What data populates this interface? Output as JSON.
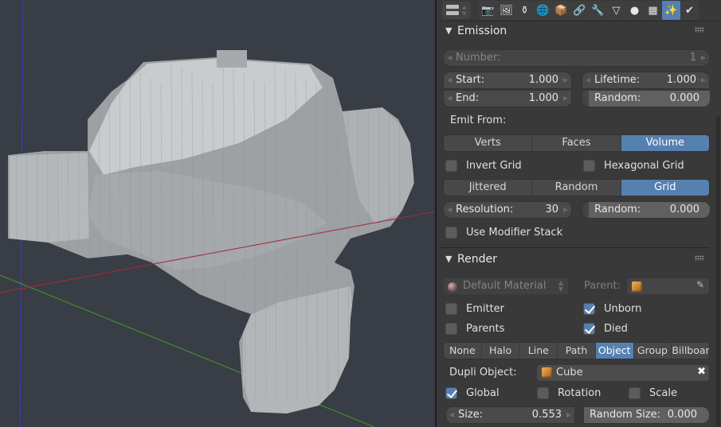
{
  "header": {
    "tabs": [
      {
        "name": "render-tab",
        "icon": "camera-icon",
        "glyph": "📷",
        "active": false
      },
      {
        "name": "render-layers-tab",
        "icon": "render-layers-icon",
        "glyph": "🖼",
        "active": false
      },
      {
        "name": "scene-tab",
        "icon": "scene-icon",
        "glyph": "⚱",
        "active": false
      },
      {
        "name": "world-tab",
        "icon": "world-icon",
        "glyph": "🌐",
        "active": false
      },
      {
        "name": "object-tab",
        "icon": "object-cube-icon",
        "glyph": "📦",
        "active": false
      },
      {
        "name": "constraints-tab",
        "icon": "link-icon",
        "glyph": "🔗",
        "active": false
      },
      {
        "name": "modifiers-tab",
        "icon": "wrench-icon",
        "glyph": "🔧",
        "active": false
      },
      {
        "name": "data-tab",
        "icon": "vertex-triangle-icon",
        "glyph": "▽",
        "active": false
      },
      {
        "name": "material-tab",
        "icon": "material-sphere-icon",
        "glyph": "●",
        "active": false
      },
      {
        "name": "texture-tab",
        "icon": "checker-texture-icon",
        "glyph": "▦",
        "active": false
      },
      {
        "name": "particles-tab",
        "icon": "particles-icon",
        "glyph": "✨",
        "active": true
      },
      {
        "name": "physics-tab",
        "icon": "physics-icon",
        "glyph": "✔",
        "active": false
      }
    ]
  },
  "emission": {
    "title": "Emission",
    "number": {
      "label": "Number:",
      "value": "1"
    },
    "start": {
      "label": "Start:",
      "value": "1.000"
    },
    "end": {
      "label": "End:",
      "value": "1.000"
    },
    "lifetime": {
      "label": "Lifetime:",
      "value": "1.000"
    },
    "lifetime_random": {
      "label": "Random:",
      "value": "0.000"
    },
    "emit_from_label": "Emit From:",
    "emit_from": {
      "options": [
        "Verts",
        "Faces",
        "Volume"
      ],
      "selected": "Volume"
    },
    "invert_grid": {
      "label": "Invert Grid",
      "checked": false
    },
    "hexagonal_grid": {
      "label": "Hexagonal Grid",
      "checked": false
    },
    "distribution": {
      "options": [
        "Jittered",
        "Random",
        "Grid"
      ],
      "selected": "Grid"
    },
    "resolution": {
      "label": "Resolution:",
      "value": "30"
    },
    "grid_random": {
      "label": "Random:",
      "value": "0.000"
    },
    "use_modifier_stack": {
      "label": "Use Modifier Stack",
      "checked": false
    }
  },
  "render": {
    "title": "Render",
    "material": "Default Material",
    "parent_label": "Parent:",
    "emitter": {
      "label": "Emitter",
      "checked": false
    },
    "parents": {
      "label": "Parents",
      "checked": false
    },
    "unborn": {
      "label": "Unborn",
      "checked": true
    },
    "died": {
      "label": "Died",
      "checked": true
    },
    "render_as": {
      "options": [
        "None",
        "Halo",
        "Line",
        "Path",
        "Object",
        "Group",
        "Billboar"
      ],
      "selected": "Object"
    },
    "dupli_object_label": "Dupli Object:",
    "dupli_object": "Cube",
    "global": {
      "label": "Global",
      "checked": true
    },
    "rotation": {
      "label": "Rotation",
      "checked": false
    },
    "scale": {
      "label": "Scale",
      "checked": false
    },
    "size": {
      "label": "Size:",
      "value": "0.553"
    },
    "random_size": {
      "label": "Random Size:",
      "value": "0.000"
    }
  },
  "colors": {
    "accent": "#5680b0",
    "viewport_bg": "#393d45",
    "panel_bg": "#393939",
    "x_axis": "#a32a35",
    "y_axis": "#3f8f2f",
    "z_axis": "#3a3ab0"
  }
}
